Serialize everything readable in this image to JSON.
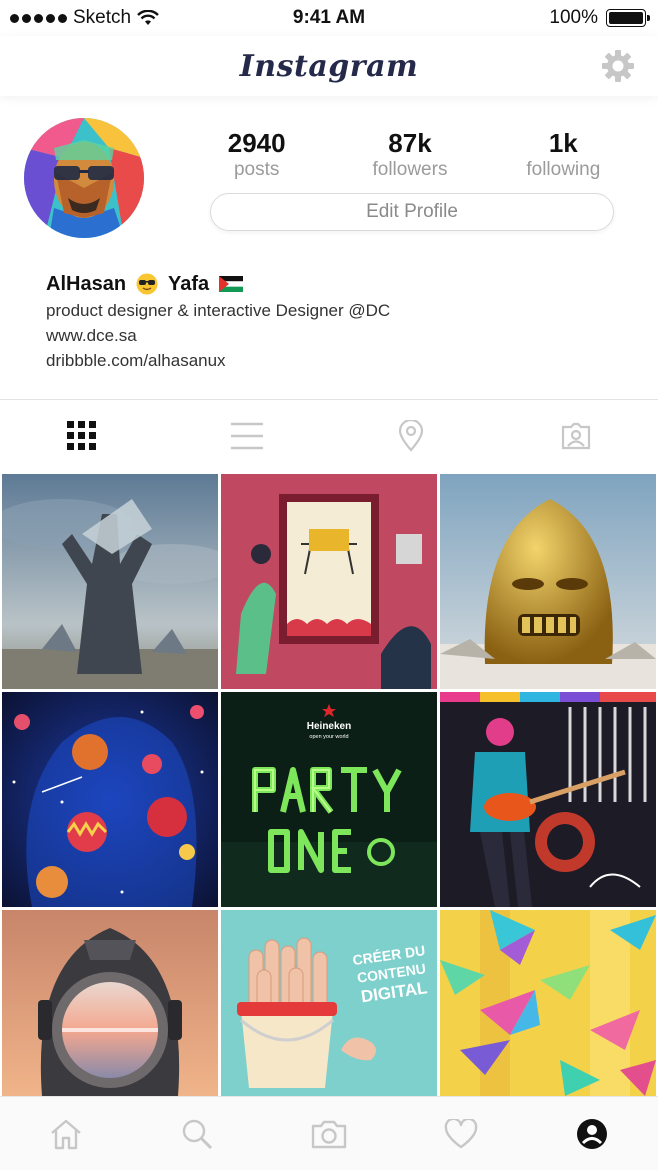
{
  "status_bar": {
    "carrier": "Sketch",
    "time": "9:41 AM",
    "battery_text": "100%",
    "battery_level": 1.0
  },
  "nav": {
    "title": "Instagram",
    "settings_icon": "gear-icon"
  },
  "profile": {
    "stats": [
      {
        "value": "2940",
        "label": "posts"
      },
      {
        "value": "87k",
        "label": "followers"
      },
      {
        "value": "1k",
        "label": "following"
      }
    ],
    "edit_label": "Edit Profile",
    "first_name": "AlHasan",
    "last_name": "Yafa",
    "bio": "product designer & interactive Designer @DC",
    "links": [
      "www.dce.sa",
      "dribbble.com/alhasanux"
    ]
  },
  "tabs": [
    {
      "icon": "grid-icon",
      "active": true
    },
    {
      "icon": "list-icon",
      "active": false
    },
    {
      "icon": "location-pin-icon",
      "active": false
    },
    {
      "icon": "tagged-photos-icon",
      "active": false
    }
  ],
  "grid_tiles": [
    {
      "icon": "stone-hand-artwork"
    },
    {
      "icon": "theater-illustration"
    },
    {
      "icon": "golden-head-artwork"
    },
    {
      "icon": "space-planets-artwork"
    },
    {
      "icon": "neon-party-artwork",
      "text_lines": [
        "Heineken",
        "open your world"
      ]
    },
    {
      "icon": "guitarist-artwork"
    },
    {
      "icon": "astronaut-helmet-artwork"
    },
    {
      "icon": "bucket-fingers-artwork",
      "text_lines": [
        "CRÉER DU",
        "CONTENU",
        "DIGITAL"
      ]
    },
    {
      "icon": "paper-planes-artwork"
    }
  ],
  "bottom_bar": [
    {
      "icon": "home-icon"
    },
    {
      "icon": "search-icon"
    },
    {
      "icon": "camera-icon"
    },
    {
      "icon": "heart-icon"
    },
    {
      "icon": "profile-icon",
      "active": true
    }
  ],
  "colors": {
    "text_primary": "#111111",
    "text_secondary": "#9b9b9b",
    "icon_inactive": "#c7c7c7",
    "icon_active": "#111111",
    "brand": "#262a4a"
  }
}
